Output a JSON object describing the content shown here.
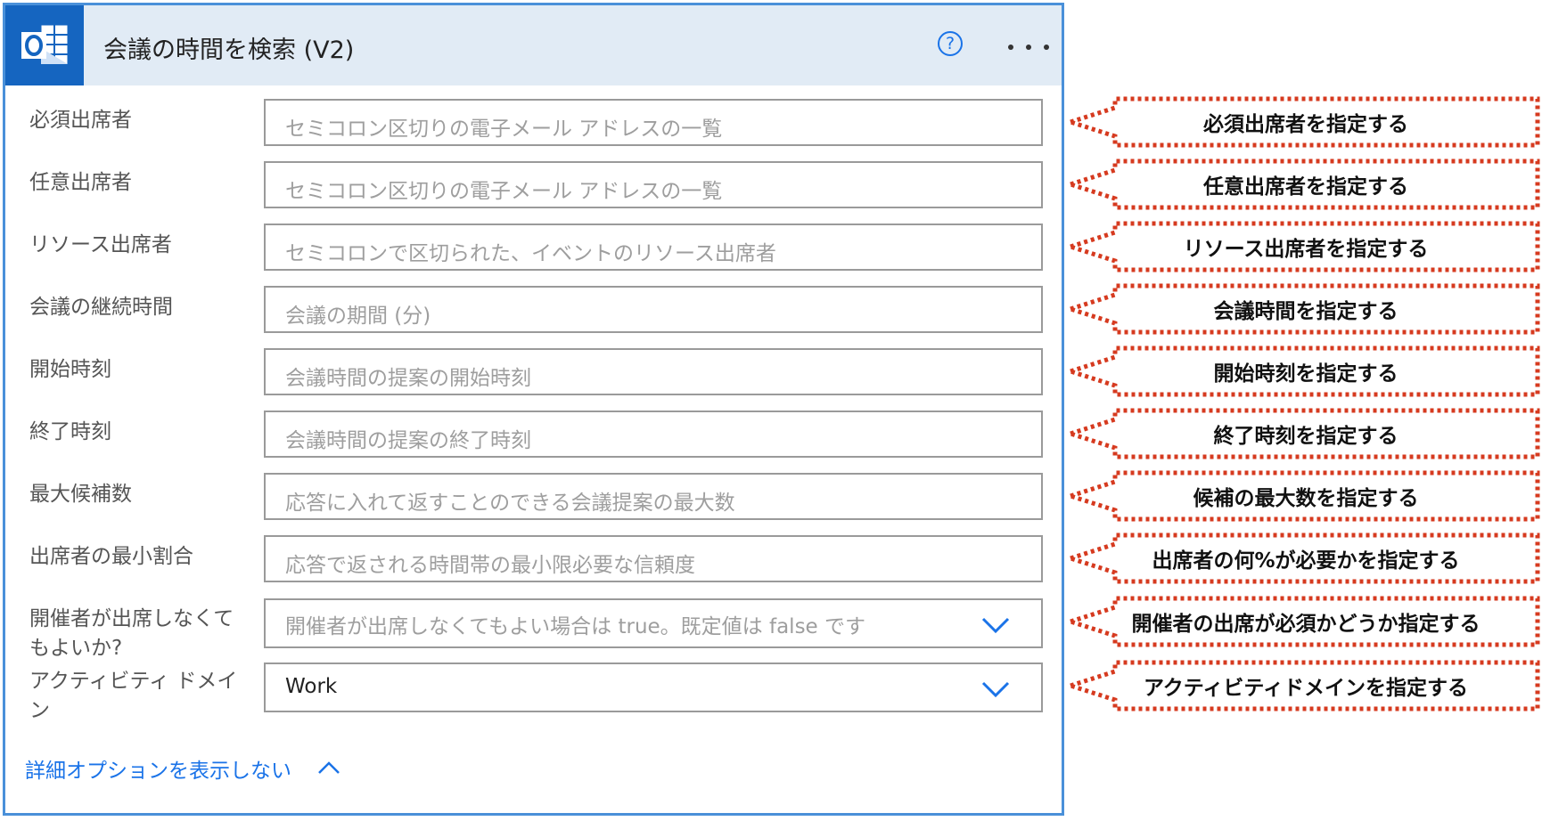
{
  "header": {
    "title": "会議の時間を検索 (V2)",
    "app_icon": "outlook-icon",
    "help_label": "?",
    "help_icon": "help-circle-icon",
    "more_icon": "more-horizontal-icon",
    "background_color": "#e1ebf5",
    "brand_color": "#1565c0"
  },
  "fields": [
    {
      "label": "必須出席者",
      "placeholder": "セミコロン区切りの電子メール アドレスの一覧",
      "value": ""
    },
    {
      "label": "任意出席者",
      "placeholder": "セミコロン区切りの電子メール アドレスの一覧",
      "value": ""
    },
    {
      "label": "リソース出席者",
      "placeholder": "セミコロンで区切られた、イベントのリソース出席者",
      "value": ""
    },
    {
      "label": "会議の継続時間",
      "placeholder": "会議の期間 (分)",
      "value": ""
    },
    {
      "label": "開始時刻",
      "placeholder": "会議時間の提案の開始時刻",
      "value": ""
    },
    {
      "label": "終了時刻",
      "placeholder": "会議時間の提案の終了時刻",
      "value": ""
    },
    {
      "label": "最大候補数",
      "placeholder": "応答に入れて返すことのできる会議提案の最大数",
      "value": ""
    },
    {
      "label": "出席者の最小割合",
      "placeholder": "応答で返される時間帯の最小限必要な信頼度",
      "value": ""
    },
    {
      "label_line1": "開催者が出席しなくて",
      "label_line2": "もよいか?",
      "placeholder": "開催者が出席しなくてもよい場合は true。既定値は false です",
      "value": "",
      "dropdown": true
    },
    {
      "label_line1": "アクティビティ ドメイ",
      "label_line2": "ン",
      "placeholder": "",
      "value": "Work",
      "dropdown": true
    }
  ],
  "advanced_options_link": "詳細オプションを表示しない",
  "callouts": [
    "必須出席者を指定する",
    "任意出席者を指定する",
    "リソース出席者を指定する",
    "会議時間を指定する",
    "開始時刻を指定する",
    "終了時刻を指定する",
    "候補の最大数を指定する",
    "出席者の何%が必要かを指定する",
    "開催者の出席が必須かどうか指定する",
    "アクティビティドメインを指定する"
  ],
  "colors": {
    "accent": "#1a73e8",
    "card_border": "#4a90d9",
    "callout_border": "#d63a1f",
    "placeholder": "#9e9e9e",
    "label": "#555555"
  }
}
